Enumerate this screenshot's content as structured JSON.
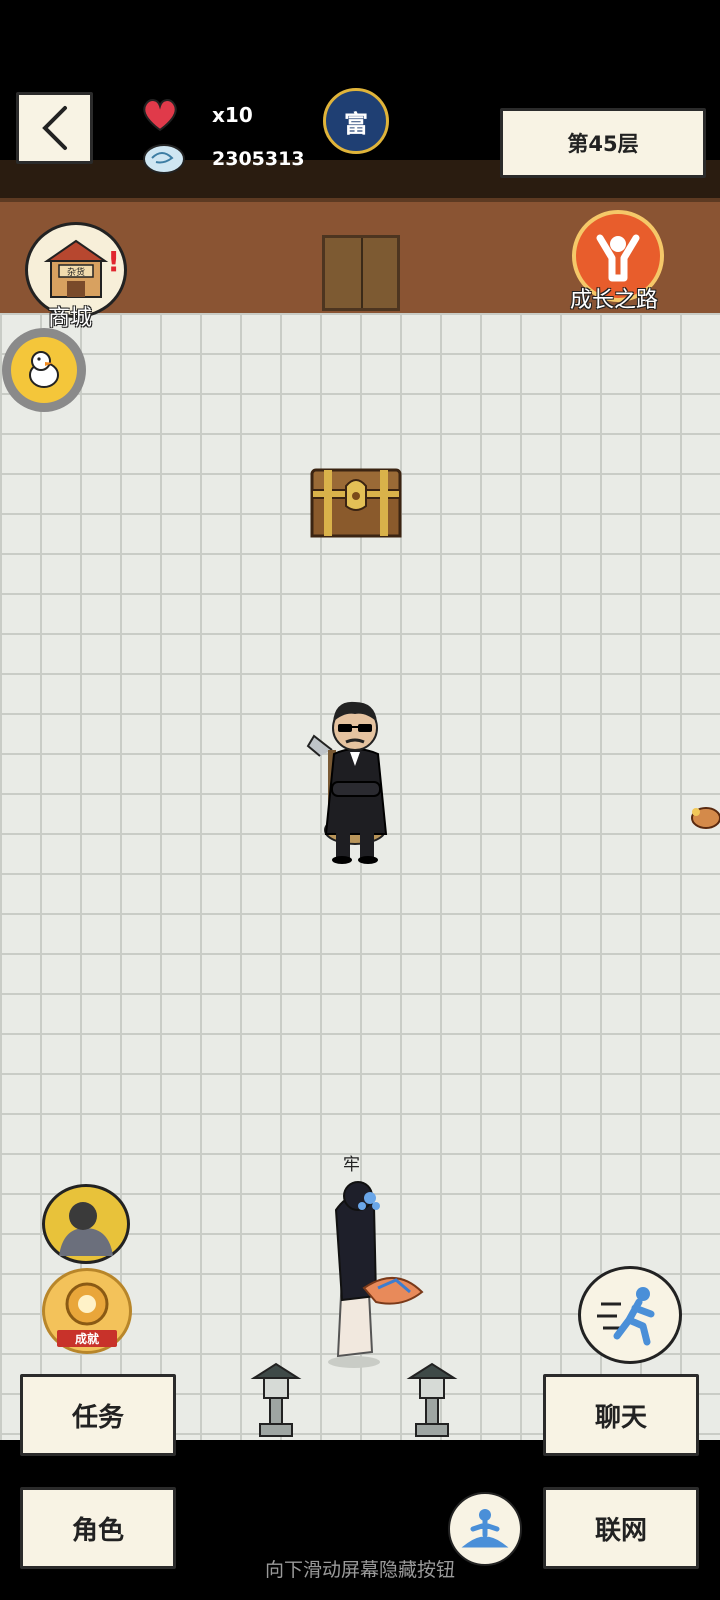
{
  "hud": {
    "lives": "x10",
    "currency": "2305313",
    "floor_label": "第45层",
    "badge_char": "富"
  },
  "buildings": {
    "shop_label": "商城",
    "shop_sign": "杂货",
    "growth_label": "成长之路"
  },
  "scene": {
    "player_tag": "牢"
  },
  "side": {
    "achievement_badge": "成就"
  },
  "bottom": {
    "task": "任务",
    "chat": "聊天",
    "role": "角色",
    "network": "联网",
    "hint": "向下滑动屏幕隐藏按钮"
  },
  "colors": {
    "brick_floor": "#e9ebe6",
    "wood_wall": "#8a5433",
    "button_paper": "#f8f3e4",
    "heart": "#e03a4a"
  }
}
